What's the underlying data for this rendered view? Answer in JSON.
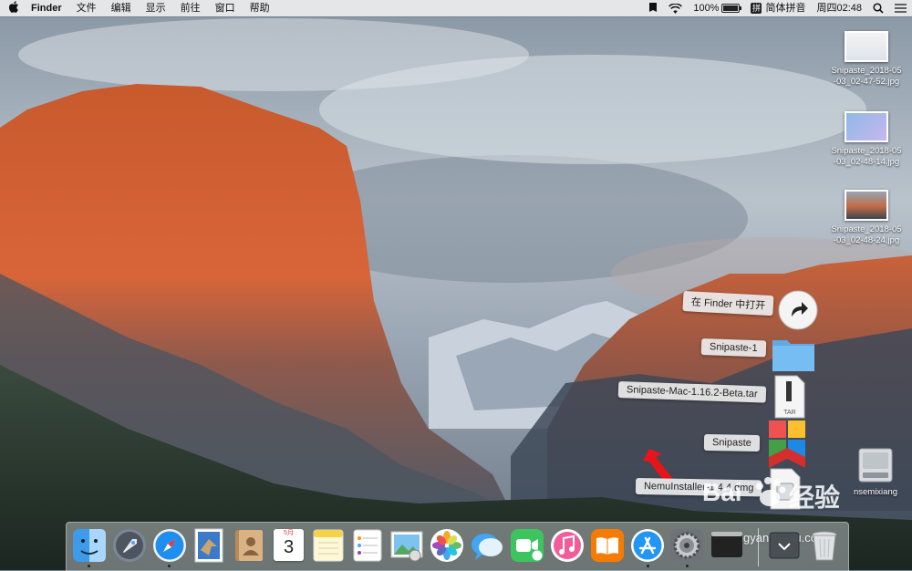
{
  "menubar": {
    "apple_icon": "apple-logo-icon",
    "app_name": "Finder",
    "menus": [
      "文件",
      "编辑",
      "显示",
      "前往",
      "窗口",
      "帮助"
    ],
    "battery_percent": "100%",
    "battery_level": 1.0,
    "input_method": "简体拼音",
    "input_method_badge": "拼",
    "clock": "周四02:48",
    "status_icons": [
      "pin-icon",
      "wifi-icon",
      "battery-icon",
      "search-icon",
      "list-icon"
    ]
  },
  "desktop_icons": [
    {
      "label": "Snipaste_2018-05\n-03_02-47-52.jpg"
    },
    {
      "label": "Snipaste_2018-05\n-03_02-48-14.jpg"
    },
    {
      "label": "Snipaste_2018-05\n-03_02-48-24.jpg"
    },
    {
      "label": "nsemixiang"
    }
  ],
  "stack": {
    "open_in_finder": "在 Finder 中打开",
    "items": [
      {
        "label": "Snipaste-1",
        "icon": "folder-icon"
      },
      {
        "label": "Snipaste-Mac-1.16.2-Beta.tar",
        "icon": "tar-file-icon"
      },
      {
        "label": "Snipaste",
        "icon": "snipaste-app-icon"
      },
      {
        "label": "NemuInstaller-1.4.4.dmg",
        "icon": "dmg-file-icon"
      }
    ]
  },
  "dock": {
    "items": [
      {
        "name": "finder",
        "running": true
      },
      {
        "name": "launchpad",
        "running": false
      },
      {
        "name": "safari",
        "running": true
      },
      {
        "name": "mail",
        "running": false
      },
      {
        "name": "contacts",
        "running": false
      },
      {
        "name": "calendar",
        "running": false,
        "month": "5月",
        "day": "3"
      },
      {
        "name": "notes",
        "running": false
      },
      {
        "name": "reminders",
        "running": false
      },
      {
        "name": "preview",
        "running": false
      },
      {
        "name": "photos",
        "running": false
      },
      {
        "name": "messages",
        "running": false
      },
      {
        "name": "facetime",
        "running": false
      },
      {
        "name": "itunes",
        "running": false
      },
      {
        "name": "ibooks",
        "running": false
      },
      {
        "name": "app-store",
        "running": true
      },
      {
        "name": "system-preferences",
        "running": true
      },
      {
        "name": "terminal",
        "running": false
      },
      {
        "name": "downloads-stack",
        "running": false
      },
      {
        "name": "trash",
        "running": false
      }
    ]
  },
  "watermark": {
    "text": "Bai",
    "text2": "经验",
    "url": "jingyan.baidu.com"
  },
  "colors": {
    "annotation_arrow": "#e8141a",
    "folder": "#6fb8f0",
    "menubar": "#ececec"
  }
}
